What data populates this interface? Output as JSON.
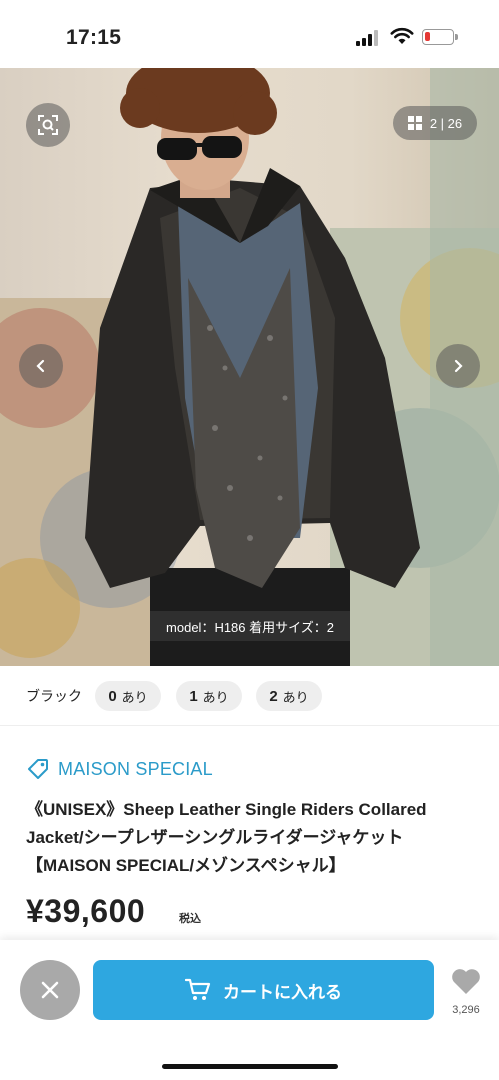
{
  "status_bar": {
    "time": "17:15",
    "battery_level": 0.2
  },
  "hero": {
    "image_counter": "2 | 26",
    "model_caption": "model：H186 着用サイズ：2",
    "icons": [
      "lens-icon",
      "grid-icon",
      "chevron-left-icon",
      "chevron-right-icon"
    ]
  },
  "colors": {
    "name": "ブラック",
    "sizes": [
      {
        "size": "0",
        "stock": "あり"
      },
      {
        "size": "1",
        "stock": "あり"
      },
      {
        "size": "2",
        "stock": "あり"
      }
    ]
  },
  "product": {
    "brand": "MAISON SPECIAL",
    "title_lines": [
      "《UNISEX》Sheep Leather Single Riders Collared",
      "Jacket/シープレザーシングルライダージャケット",
      "【MAISON SPECIAL/メゾンスペシャル】"
    ],
    "price": "¥39,600",
    "tax_label": "税込"
  },
  "bottom_bar": {
    "cart_label": "カートに入れる",
    "favorite_count": "3,296"
  },
  "colors_theme": {
    "accent": "#2ea7e0",
    "brand_text": "#2b9bc9",
    "close_button": "#a9a9a9"
  }
}
